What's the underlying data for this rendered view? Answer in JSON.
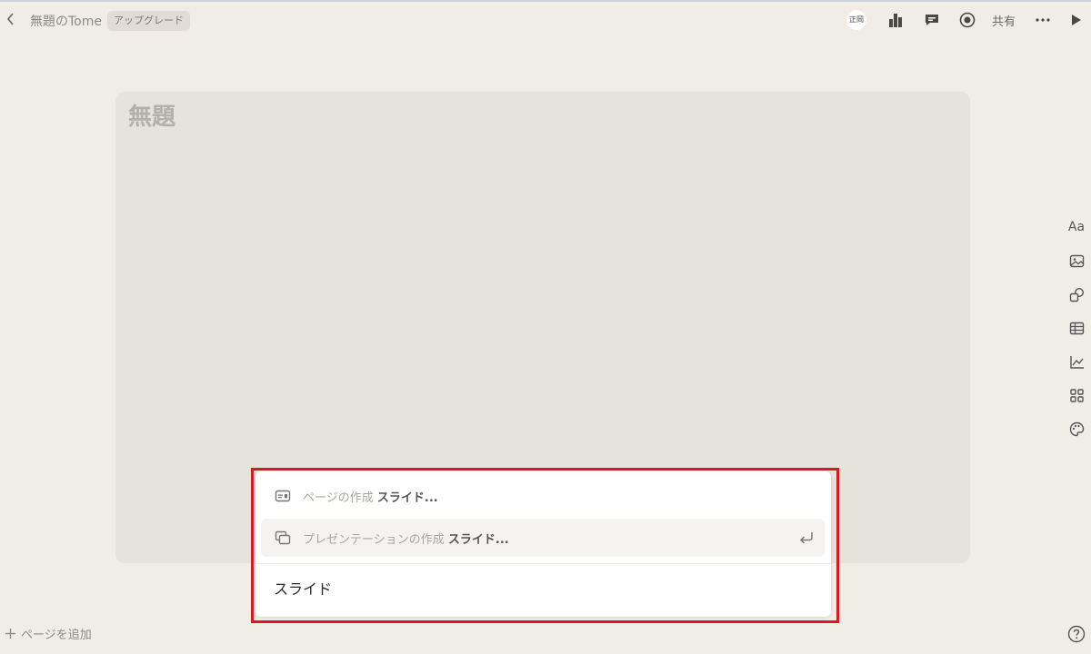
{
  "header": {
    "doc_title": "無題のTome",
    "upgrade_label": "アップグレード",
    "avatar_text": "正岡",
    "share_label": "共有"
  },
  "slide": {
    "title": "無題"
  },
  "right_toolbar": {
    "text_label": "Aa"
  },
  "footer": {
    "add_page_label": "ページを追加"
  },
  "command_popup": {
    "suggestions": [
      {
        "prefix": "ページの作成",
        "subject": "スライド..."
      },
      {
        "prefix": "プレゼンテーションの作成",
        "subject": "スライド..."
      }
    ],
    "input_value": "スライド"
  },
  "colors": {
    "background": "#f0ede7",
    "slide_background": "#e6e2dc",
    "highlight_border": "#d61b24"
  }
}
